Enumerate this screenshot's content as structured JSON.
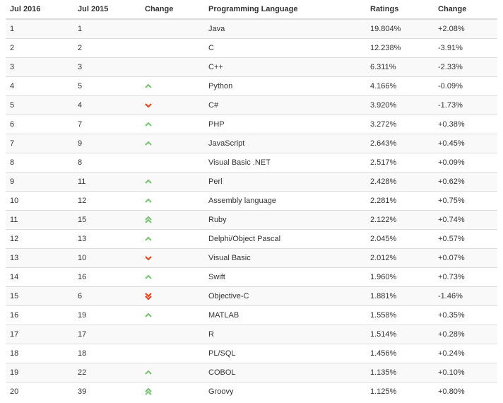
{
  "headers": [
    "Jul 2016",
    "Jul 2015",
    "Change",
    "Programming Language",
    "Ratings",
    "Change"
  ],
  "colors": {
    "up": "#7cc576",
    "down": "#e9471d"
  },
  "rows": [
    {
      "jul2016": "1",
      "jul2015": "1",
      "trend": "none",
      "language": "Java",
      "rating": "19.804%",
      "change": "+2.08%"
    },
    {
      "jul2016": "2",
      "jul2015": "2",
      "trend": "none",
      "language": "C",
      "rating": "12.238%",
      "change": "-3.91%"
    },
    {
      "jul2016": "3",
      "jul2015": "3",
      "trend": "none",
      "language": "C++",
      "rating": "6.311%",
      "change": "-2.33%"
    },
    {
      "jul2016": "4",
      "jul2015": "5",
      "trend": "up",
      "language": "Python",
      "rating": "4.166%",
      "change": "-0.09%"
    },
    {
      "jul2016": "5",
      "jul2015": "4",
      "trend": "down",
      "language": "C#",
      "rating": "3.920%",
      "change": "-1.73%"
    },
    {
      "jul2016": "6",
      "jul2015": "7",
      "trend": "up",
      "language": "PHP",
      "rating": "3.272%",
      "change": "+0.38%"
    },
    {
      "jul2016": "7",
      "jul2015": "9",
      "trend": "up",
      "language": "JavaScript",
      "rating": "2.643%",
      "change": "+0.45%"
    },
    {
      "jul2016": "8",
      "jul2015": "8",
      "trend": "none",
      "language": "Visual Basic .NET",
      "rating": "2.517%",
      "change": "+0.09%"
    },
    {
      "jul2016": "9",
      "jul2015": "11",
      "trend": "up",
      "language": "Perl",
      "rating": "2.428%",
      "change": "+0.62%"
    },
    {
      "jul2016": "10",
      "jul2015": "12",
      "trend": "up",
      "language": "Assembly language",
      "rating": "2.281%",
      "change": "+0.75%"
    },
    {
      "jul2016": "11",
      "jul2015": "15",
      "trend": "up2",
      "language": "Ruby",
      "rating": "2.122%",
      "change": "+0.74%"
    },
    {
      "jul2016": "12",
      "jul2015": "13",
      "trend": "up",
      "language": "Delphi/Object Pascal",
      "rating": "2.045%",
      "change": "+0.57%"
    },
    {
      "jul2016": "13",
      "jul2015": "10",
      "trend": "down",
      "language": "Visual Basic",
      "rating": "2.012%",
      "change": "+0.07%"
    },
    {
      "jul2016": "14",
      "jul2015": "16",
      "trend": "up",
      "language": "Swift",
      "rating": "1.960%",
      "change": "+0.73%"
    },
    {
      "jul2016": "15",
      "jul2015": "6",
      "trend": "down2",
      "language": "Objective-C",
      "rating": "1.881%",
      "change": "-1.46%"
    },
    {
      "jul2016": "16",
      "jul2015": "19",
      "trend": "up",
      "language": "MATLAB",
      "rating": "1.558%",
      "change": "+0.35%"
    },
    {
      "jul2016": "17",
      "jul2015": "17",
      "trend": "none",
      "language": "R",
      "rating": "1.514%",
      "change": "+0.28%"
    },
    {
      "jul2016": "18",
      "jul2015": "18",
      "trend": "none",
      "language": "PL/SQL",
      "rating": "1.456%",
      "change": "+0.24%"
    },
    {
      "jul2016": "19",
      "jul2015": "22",
      "trend": "up",
      "language": "COBOL",
      "rating": "1.135%",
      "change": "+0.10%"
    },
    {
      "jul2016": "20",
      "jul2015": "39",
      "trend": "up2",
      "language": "Groovy",
      "rating": "1.125%",
      "change": "+0.80%"
    }
  ]
}
